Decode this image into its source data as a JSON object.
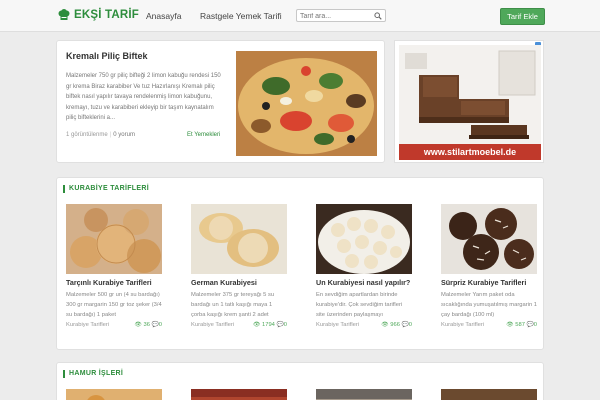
{
  "header": {
    "logo": "EKŞİ TARİF",
    "nav": {
      "home": "Anasayfa",
      "random": "Rastgele Yemek Tarifi"
    },
    "search_placeholder": "Tarif ara...",
    "add_button": "Tarif Ekle"
  },
  "featured": {
    "title": "Kremalı Piliç Biftek",
    "description": "Malzemeler 750 gr piliç bifteği 2 limon kabuğu rendesi 150 gr krema Biraz karabiber Ve tuz Hazırlanışı Kremalı piliç biftek nasıl yapılır tavaya rendelenmiş limon kabuğunu, kremayı, tuzu ve karabiberi ekleyip bir taşım kaynatalım piliç bifteklerini a...",
    "views": "1 görüntülenme",
    "comments": "0 yorum",
    "category": "Et Yemekleri"
  },
  "ad": {
    "url_text": "www.stilartmoebel.de"
  },
  "sections": {
    "kurabiye": {
      "title": "KURABİYE TARİFLERİ",
      "cards": [
        {
          "title": "Tarçınlı Kurabiye Tarifleri",
          "desc": "Malzemeler 500 gr un (4 su bardağı) 300 gr margarin 150 gr toz şeker (3/4 su bardağı) 1 paket",
          "category": "Kurabiye Tarifleri",
          "views": "36",
          "comments": "0"
        },
        {
          "title": "German Kurabiyesi",
          "desc": "Malzemeler 375 gr tereyağı 5 su bardağı un 1 tatlı kaşığı maya 1 çorba kaşığı krem şanti 2 adet",
          "category": "Kurabiye Tarifleri",
          "views": "1794",
          "comments": "0"
        },
        {
          "title": "Un Kurabiyesi nasıl yapılır?",
          "desc": "En sevdiğim apartlardan birinde kurabiye'dir. Çok sevdiğim tarifleri site üzerinden paylaşmayı",
          "category": "Kurabiye Tarifleri",
          "views": "966",
          "comments": "0"
        },
        {
          "title": "Sürpriz Kurabiye Tarifleri",
          "desc": "Malzemeler Yarım paket oda sıcaklığında yumuşatılmış margarin 1 çay bardağı (100 ml)",
          "category": "Kurabiye Tarifleri",
          "views": "587",
          "comments": "0"
        }
      ]
    },
    "hamur": {
      "title": "HAMUR İŞLERİ"
    }
  },
  "colors": {
    "brand": "#2d8d3c",
    "button": "#4fa85a",
    "background": "#ececec"
  }
}
